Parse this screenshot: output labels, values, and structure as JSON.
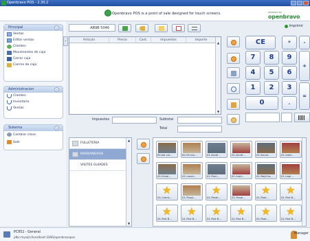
{
  "window": {
    "title": "Openbravo POS - 2.30.2"
  },
  "banner": {
    "message": "Openbravo POS is a point of sale designed for touch screens.",
    "brand_small": "powered by",
    "brand_name": "openbravo"
  },
  "sidebar": {
    "main": {
      "title": "Principal",
      "items": [
        "Ventas",
        "Editar ventas",
        "Clientes",
        "Movimientos de caja",
        "Cerrar caja",
        "Cierres de caja"
      ]
    },
    "admin": {
      "title": "Administracion",
      "items": [
        "Clientes",
        "Inventario",
        "Ventas"
      ]
    },
    "system": {
      "title": "Sistema",
      "items": [
        "Cambiar clave",
        "Salir"
      ]
    }
  },
  "ticket": {
    "number": "AB9B 5046",
    "columns": [
      "Artículo",
      "Precio",
      "Cant.",
      "Impuestos",
      "Importe"
    ],
    "taxes_label": "Impuestos",
    "subtotal_label": "Subtotal",
    "total_label": "Total"
  },
  "keypad": {
    "keys": [
      "CE",
      "*",
      "-",
      "7",
      "8",
      "9",
      "+",
      "4",
      "5",
      "6",
      "1",
      "2",
      "3",
      "=",
      "0",
      "."
    ]
  },
  "print_label": "Imprimir",
  "categories": [
    "FULLETERIA",
    "MARKANDASIE",
    "VISITES GUIADES"
  ],
  "products": [
    "BI-dai cal...",
    "BI-CD blu...",
    "01-Anatl...",
    "01-Anatl...",
    "01-Ancal...",
    "01-Inatl...",
    "01-Eraal...",
    "01-Lonal...",
    "01-Ponl...",
    "01-Inatl...",
    "01-Rajd ta...",
    "01-Lopl...",
    "01-Llanis...",
    "01-Posol...",
    "01-Posal...",
    "01-Posal...",
    "01-Poal...",
    "01-Pod B...",
    "01-Pod B...",
    "01-Pod B...",
    "01-Pod B...",
    "01-Pod B...",
    "01-Poal...",
    "01-Pod B..."
  ],
  "status": {
    "terminal": "PC852 - General",
    "db": "jdbc:mysql://localhost:3306/openbravopos",
    "user": "Manager"
  }
}
